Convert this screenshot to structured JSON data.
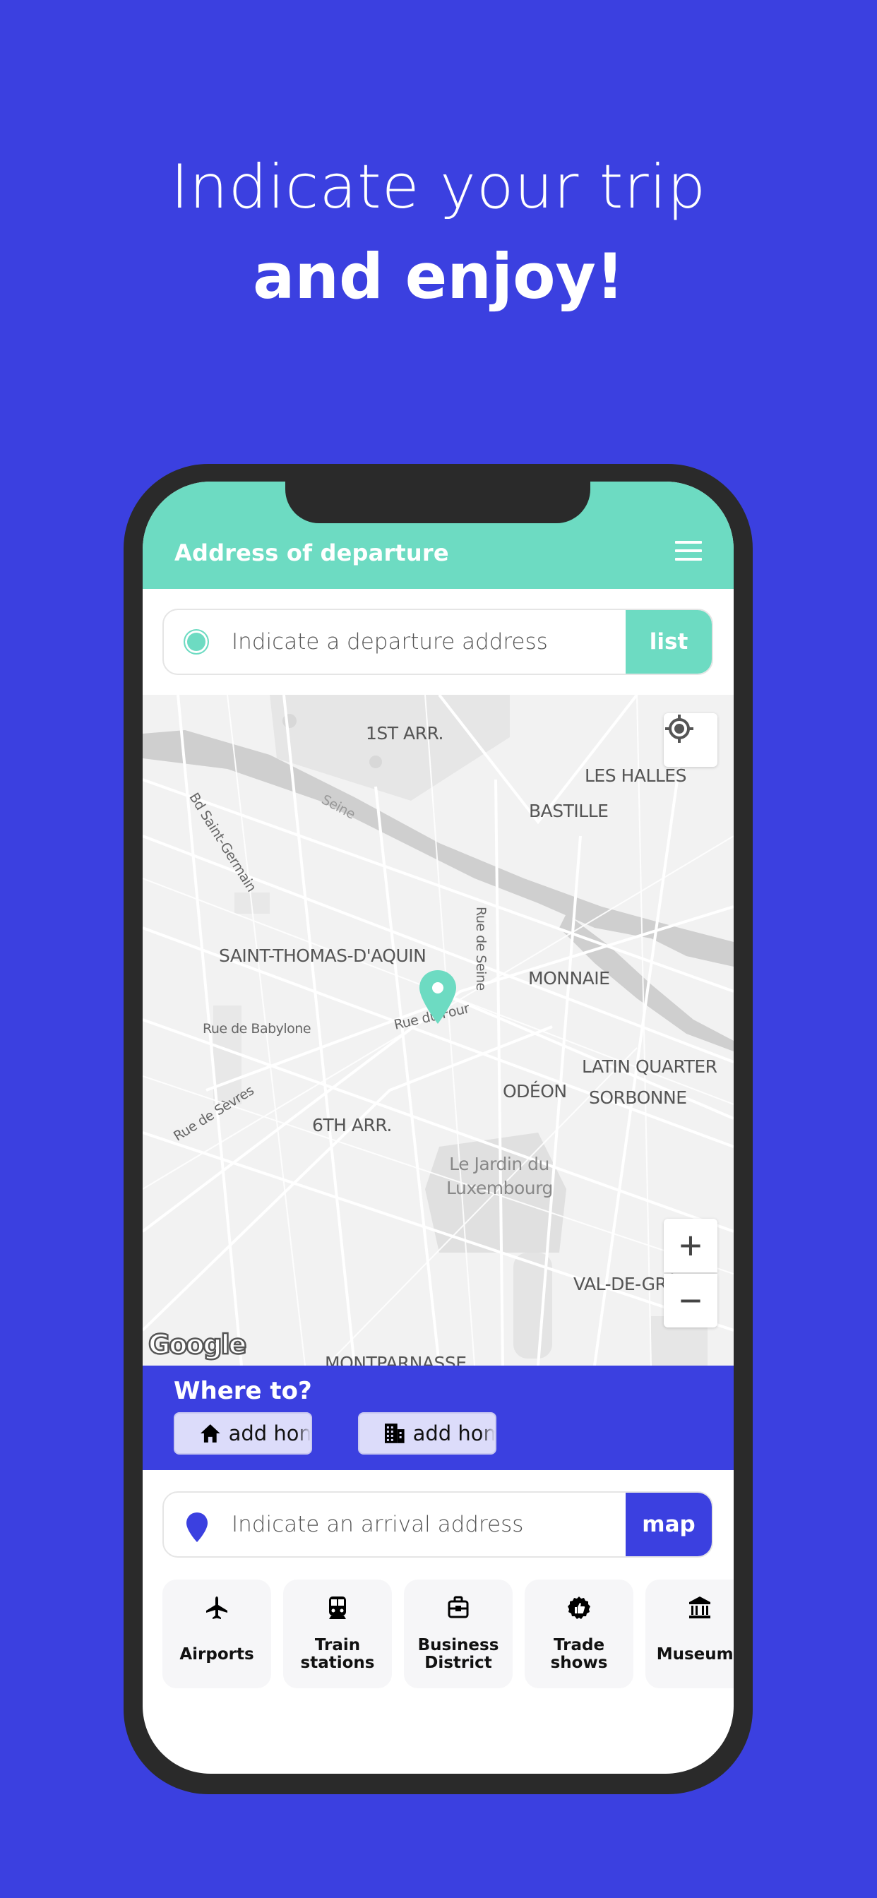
{
  "headline": {
    "line1": "Indicate your trip",
    "line2": "and enjoy!"
  },
  "app": {
    "header_title": "Address of departure",
    "menu_icon": "hamburger-menu-icon",
    "departure": {
      "placeholder": "Indicate a departure address",
      "button_label": "list",
      "icon": "departure-dot-icon"
    },
    "map": {
      "labels": {
        "arr1": "1ST ARR.",
        "les_halles": "LES HALLES",
        "bastille": "BASTILLE",
        "seine": "Seine",
        "bd_st_germain": "Bd Saint-Germain",
        "rue_de_seine": "Rue de Seine",
        "st_thomas": "SAINT-THOMAS-D'AQUIN",
        "monnaie": "MONNAIE",
        "rue_du_four": "Rue du Four",
        "rue_babylone": "Rue de Babylone",
        "latin_quarter": "LATIN QUARTER",
        "odeon": "ODÉON",
        "sorbonne": "SORBONNE",
        "rue_sevres": "Rue de Sèvres",
        "arr6": "6TH ARR.",
        "jardin_line1": "Le Jardin du",
        "jardin_line2": "Luxembourg",
        "val_de_grace": "VAL-DE-GRÂCE",
        "montparnasse": "MONTPARNASSE"
      },
      "attribution": "Google",
      "zoom_in": "+",
      "zoom_out": "−",
      "locate_icon": "my-location-icon",
      "pin_color": "#6ddbc2"
    },
    "where_to": {
      "title": "Where to?",
      "chips": [
        {
          "icon": "home-icon",
          "label": "add home"
        },
        {
          "icon": "building-icon",
          "label": "add home"
        }
      ]
    },
    "arrival": {
      "placeholder": "Indicate an arrival address",
      "button_label": "map",
      "icon": "map-pin-icon"
    },
    "categories": [
      {
        "icon": "airplane-icon",
        "label": "Airports"
      },
      {
        "icon": "train-icon",
        "label": "Train\nstations"
      },
      {
        "icon": "briefcase-icon",
        "label": "Business\nDistrict"
      },
      {
        "icon": "thumbs-up-badge-icon",
        "label": "Trade\nshows"
      },
      {
        "icon": "museum-icon",
        "label": "Museums"
      }
    ]
  },
  "colors": {
    "background": "#3b40e0",
    "accent_teal": "#6ddbc2",
    "accent_blue": "#3b40e0",
    "phone_frame": "#2a2a2a"
  }
}
